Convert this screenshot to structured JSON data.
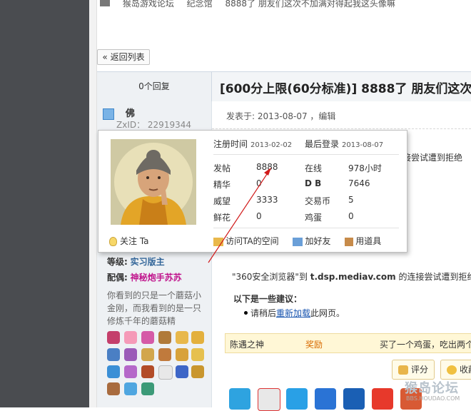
{
  "breadcrumb": {
    "items": [
      "猴岛游戏论坛",
      "纪念馆",
      "8888了  朋友们这次不加满对得起我这头像嘛"
    ]
  },
  "back_button": "« 返回列表",
  "thread": {
    "reply_count": "0个回复",
    "title": "[600分上限(60分标准)] 8888了  朋友们这次不"
  },
  "author": {
    "name": "佛",
    "zxid": "ZxID： 22919344",
    "level_label": "等级:",
    "level_value": "实习版主",
    "mate_label": "配偶:",
    "mate_value": "神秘炮手苏苏",
    "signature": "你看到的只是一个蘑菇小金刚，而我看到的是一只修炼千年的蘑菇精"
  },
  "post": {
    "meta": "发表于: 2013-08-07  ，编辑",
    "behind_text": "接尝试遭到拒绝",
    "error_quote_prefix": "\"360安全浏览器\"到 ",
    "error_quote_bold": "t.dsp.mediav.com",
    "error_quote_suffix": " 的连接尝试遭到拒绝",
    "suggest_title": "以下是一些建议：",
    "suggest_prefix": "请稍后",
    "suggest_link": "重新加载",
    "suggest_suffix": "此网页。"
  },
  "popup": {
    "reg_label": "注册时间",
    "reg_date": "2013-02-02",
    "login_label": "最后登录",
    "login_date": "2013-08-07",
    "stats": [
      {
        "l1": "发帖",
        "v1": "8888",
        "l2": "在线",
        "v2": "978小时"
      },
      {
        "l1": "精华",
        "v1": "0",
        "l2": "D B",
        "v2": "7646"
      },
      {
        "l1": "威望",
        "v1": "3333",
        "l2": "交易币",
        "v2": "5"
      },
      {
        "l1": "鲜花",
        "v1": "0",
        "l2": "鸡蛋",
        "v2": "0"
      }
    ],
    "follow": "关注 Ta",
    "actions": [
      "访问TA的空间",
      "加好友",
      "用道具"
    ]
  },
  "log": {
    "user": "陈遇之神",
    "type": "奖励",
    "desc": "买了一个鸡蛋，吃出两个"
  },
  "buttons": {
    "rate": "评分",
    "fav": "收藏"
  },
  "watermark": {
    "main": "猴岛论坛",
    "sub": "BBS.HOUDAO.COM"
  },
  "colors": {
    "accent_link": "#1a56b0",
    "level": "#336699",
    "mate": "#c0148c",
    "reward": "#d86a00",
    "arrow": "#d11a1a"
  }
}
